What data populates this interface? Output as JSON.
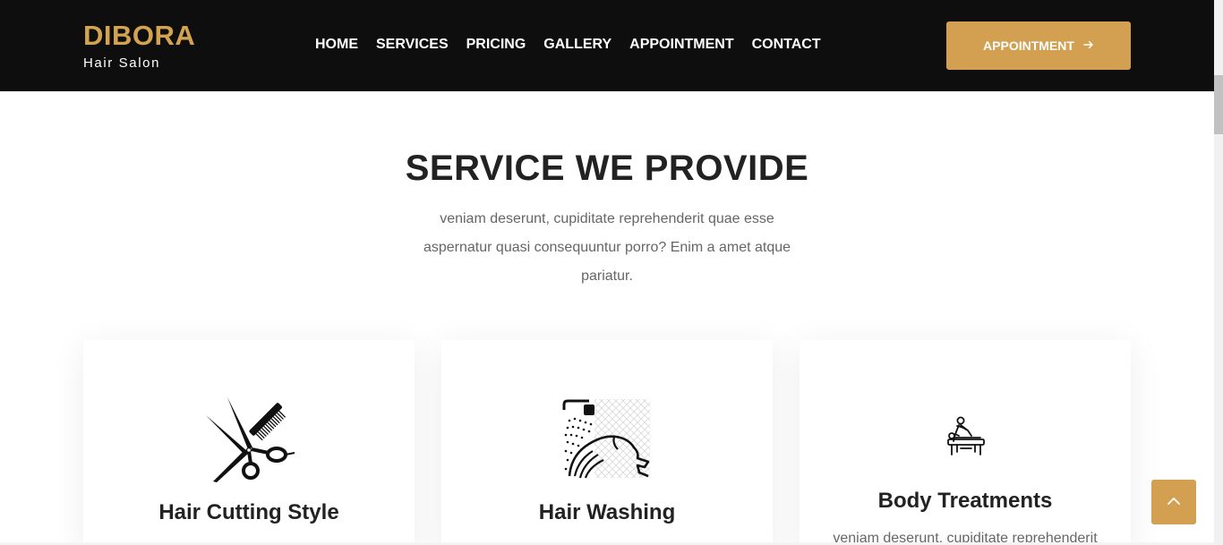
{
  "brand": {
    "name": "DIBORA",
    "tagline": "Hair Salon"
  },
  "nav": {
    "items": [
      {
        "label": "HOME"
      },
      {
        "label": "SERVICES"
      },
      {
        "label": "PRICING"
      },
      {
        "label": "GALLERY"
      },
      {
        "label": "APPOINTMENT"
      },
      {
        "label": "CONTACT"
      }
    ]
  },
  "header_button": {
    "label": "APPOINTMENT",
    "icon": "arrow-right-icon"
  },
  "section": {
    "title": "SERVICE WE PROVIDE",
    "description": "veniam deserunt, cupiditate reprehenderit quae esse aspernatur quasi consequuntur porro? Enim a amet atque pariatur."
  },
  "services": [
    {
      "title": "Hair Cutting Style",
      "icon": "scissors-comb-icon",
      "text": ""
    },
    {
      "title": "Hair Washing",
      "icon": "hair-washing-icon",
      "text": ""
    },
    {
      "title": "Body Treatments",
      "icon": "massage-table-icon",
      "text": "veniam deserunt, cupiditate reprehenderit"
    }
  ],
  "back_to_top": {
    "icon": "chevron-up-icon"
  },
  "colors": {
    "accent": "#d3a052",
    "header_bg": "#0e0e0e",
    "heading": "#222222",
    "body_text": "#666666"
  }
}
